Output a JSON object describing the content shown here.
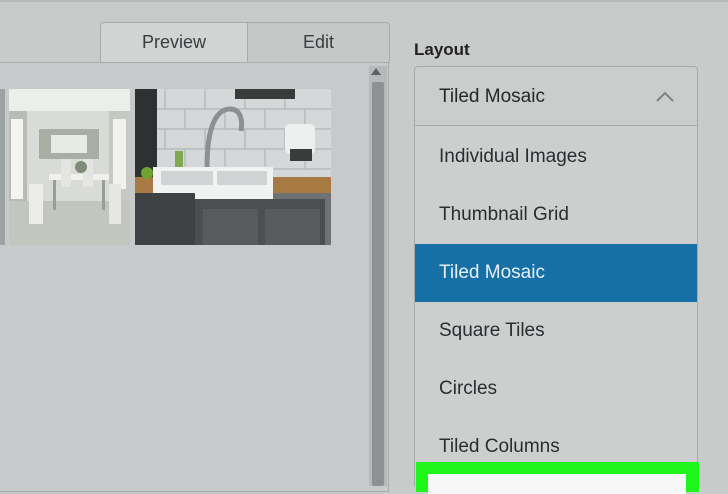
{
  "tabs": {
    "preview": "Preview",
    "edit": "Edit"
  },
  "layout": {
    "label": "Layout",
    "selected": "Tiled Mosaic",
    "options": [
      "Individual Images",
      "Thumbnail Grid",
      "Tiled Mosaic",
      "Square Tiles",
      "Circles",
      "Tiled Columns"
    ],
    "selected_index": 2
  },
  "colors": {
    "selected_option_bg": "#1670a6",
    "highlight": "#1ef51a"
  },
  "gallery": {
    "images": [
      "partial-photo",
      "dining-room-photo",
      "kitchen-sink-photo"
    ]
  }
}
